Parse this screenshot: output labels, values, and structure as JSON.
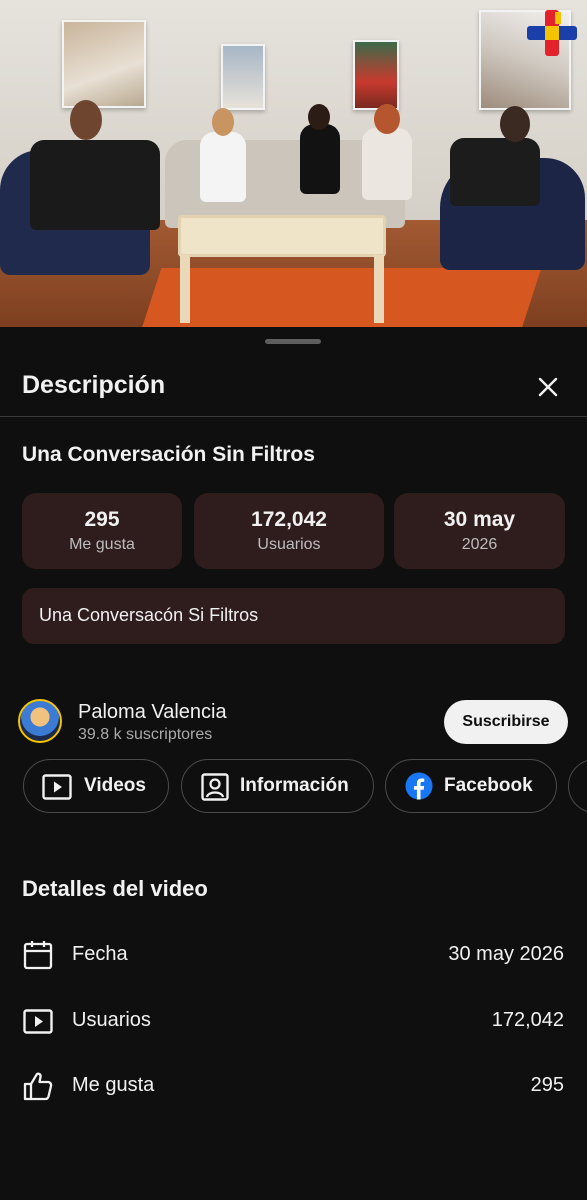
{
  "sheet": {
    "title": "Descripción"
  },
  "video": {
    "title": "Una Conversación Sin Filtros",
    "stats": [
      {
        "value": "295",
        "label": "Me gusta"
      },
      {
        "value": "172,042",
        "label": "Usuarios"
      },
      {
        "value": "30 may",
        "label": "2026"
      }
    ],
    "description": "Una Conversacón Si Filtros"
  },
  "channel": {
    "name": "Paloma Valencia",
    "subscribers": "39.8 k suscriptores",
    "subscribe_label": "Suscribirse"
  },
  "chips": [
    {
      "label": "Videos",
      "icon": "video-play-icon"
    },
    {
      "label": "Información",
      "icon": "person-card-icon"
    },
    {
      "label": "Facebook",
      "icon": "facebook-icon"
    }
  ],
  "details": {
    "title": "Detalles del video",
    "rows": [
      {
        "label": "Fecha",
        "value": "30 may 2026",
        "icon": "calendar-icon"
      },
      {
        "label": "Usuarios",
        "value": "172,042",
        "icon": "video-play-icon"
      },
      {
        "label": "Me gusta",
        "value": "295",
        "icon": "thumbs-up-icon"
      }
    ]
  },
  "colors": {
    "background": "#0f0f0f",
    "card": "#2e1d1c",
    "text": "#f1f1f1",
    "muted": "#aaaaaa",
    "facebook": "#1877f2"
  }
}
